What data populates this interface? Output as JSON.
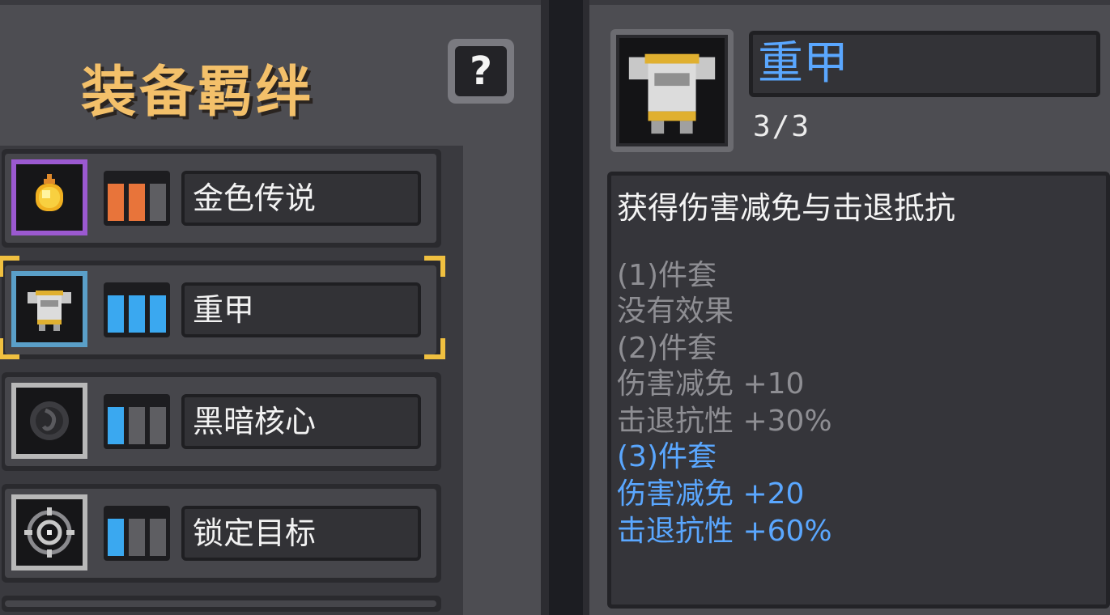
{
  "panel_title": "装备羁绊",
  "help_label": "?",
  "sets": [
    {
      "name": "金色传说",
      "icon": "golden-orb-icon",
      "frame_color": "#9b59d0",
      "bar_color": "#e8743a",
      "filled": 2,
      "total": 3
    },
    {
      "name": "重甲",
      "icon": "heavy-armor-icon",
      "frame_color": "#5a9fc8",
      "bar_color": "#3aa8f0",
      "filled": 3,
      "total": 3,
      "selected": true
    },
    {
      "name": "黑暗核心",
      "icon": "dark-core-icon",
      "frame_color": "#b8b8b8",
      "bar_color": "#3aa8f0",
      "filled": 1,
      "total": 3
    },
    {
      "name": "锁定目标",
      "icon": "target-lock-icon",
      "frame_color": "#b8b8b8",
      "bar_color": "#3aa8f0",
      "filled": 1,
      "total": 3
    }
  ],
  "detail": {
    "name": "重甲",
    "count": "3/3",
    "description": "获得伤害减免与击退抵抗",
    "tiers": [
      {
        "label": "(1)件套",
        "lines": [
          "没有效果"
        ],
        "active": false
      },
      {
        "label": "(2)件套",
        "lines": [
          "伤害减免 +10",
          "击退抗性 +30%"
        ],
        "active": false
      },
      {
        "label": "(3)件套",
        "lines": [
          "伤害减免 +20",
          "击退抗性 +60%"
        ],
        "active": true
      }
    ]
  },
  "colors": {
    "title_gold": "#f3c06a",
    "active_blue": "#5aa7ff",
    "inactive_gray": "#8e8e93",
    "selection_corner": "#f0c040"
  }
}
